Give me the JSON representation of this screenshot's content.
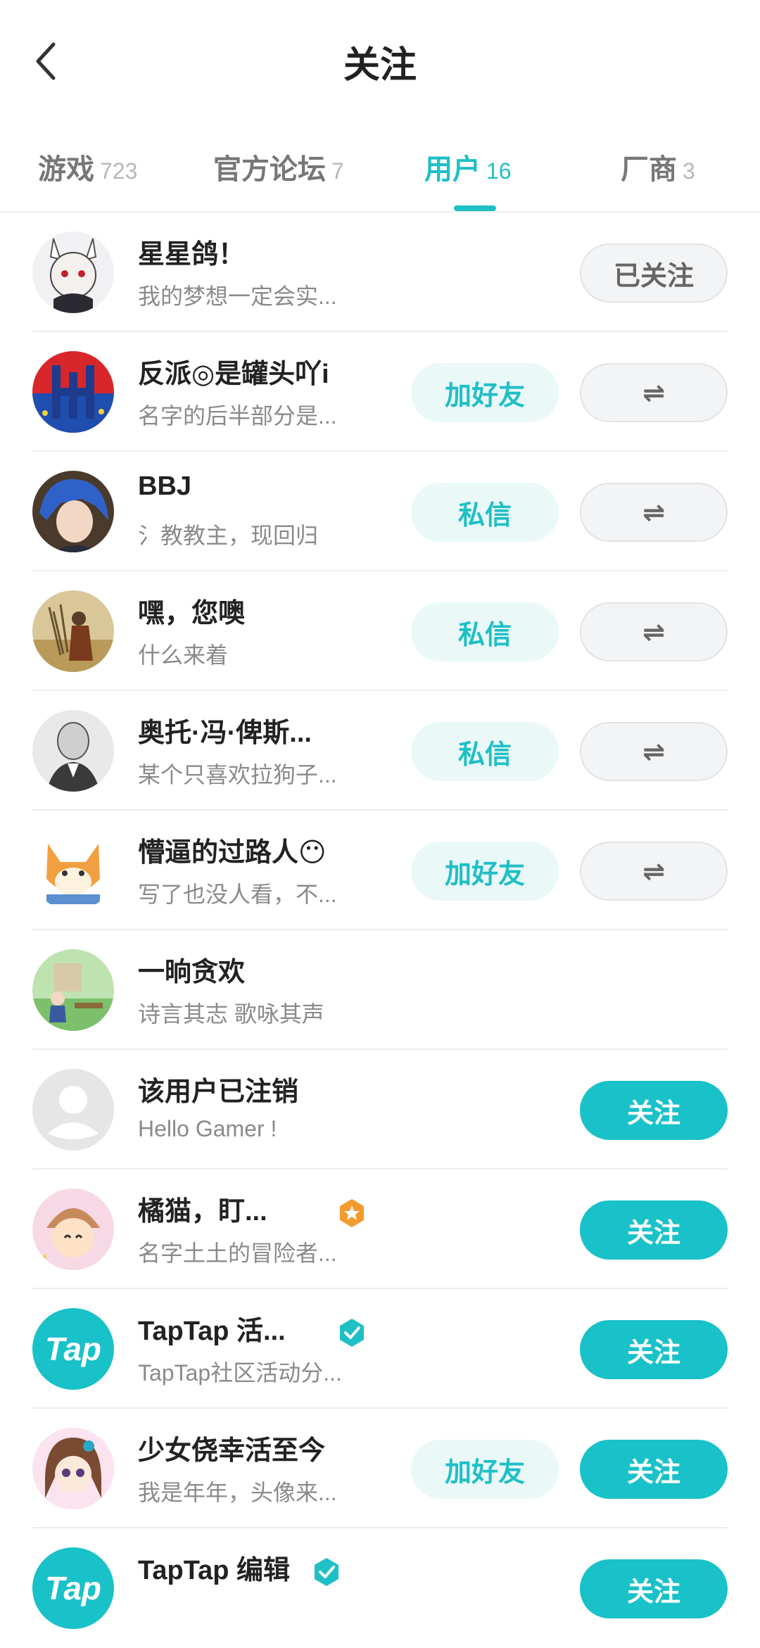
{
  "header": {
    "title": "关注"
  },
  "tabs": [
    {
      "label": "游戏",
      "count": "723"
    },
    {
      "label": "官方论坛",
      "count": "7"
    },
    {
      "label": "用户",
      "count": "16"
    },
    {
      "label": "厂商",
      "count": "3"
    }
  ],
  "buttons": {
    "followed": "已关注",
    "add_friend": "加好友",
    "message": "私信",
    "follow": "关注",
    "mutual_icon": "⇌"
  },
  "users": [
    {
      "name": "星星鸽！",
      "desc": "我的梦想一定会实..."
    },
    {
      "name": "反派◎是罐头吖i",
      "desc": "名字的后半部分是..."
    },
    {
      "name": "BBJ",
      "desc": "氵教教主，现回归"
    },
    {
      "name": "嘿，您噢",
      "desc": "什么来着"
    },
    {
      "name": "奥托·冯·俾斯...",
      "desc": "某个只喜欢拉狗子..."
    },
    {
      "name": "懵逼的过路人😶",
      "desc": "写了也没人看，不..."
    },
    {
      "name": "一晌贪欢",
      "desc": "诗言其志 歌咏其声"
    },
    {
      "name": "该用户已注销",
      "desc": "Hello Gamer !"
    },
    {
      "name": "橘猫，盯...",
      "desc": "名字土土的冒险者..."
    },
    {
      "name": "TapTap 活...",
      "desc": "TapTap社区活动分..."
    },
    {
      "name": "少女侥幸活至今",
      "desc": "我是年年，头像来..."
    },
    {
      "name": "TapTap 编辑",
      "desc": ""
    }
  ],
  "logo_text": "Tap",
  "colors": {
    "accent": "#1fbfc6",
    "badge_orange": "#f39a2c",
    "badge_verified": "#1fbfc6"
  }
}
